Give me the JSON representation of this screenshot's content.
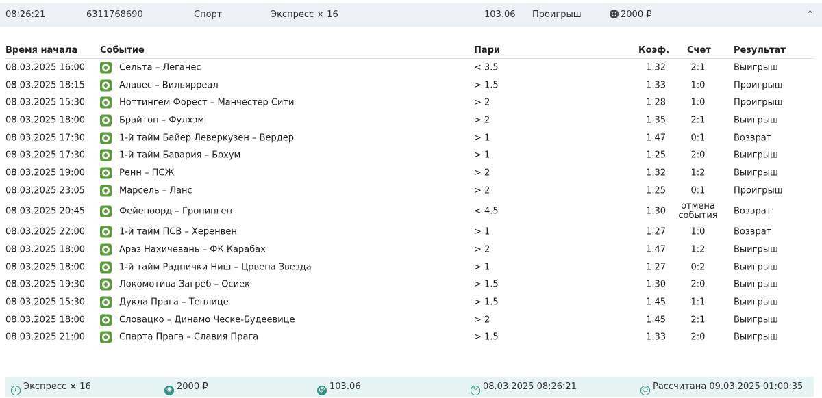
{
  "topbar": {
    "time": "08:26:21",
    "id": "6311768690",
    "category": "Спорт",
    "type": "Экспресс × 16",
    "coef": "103.06",
    "status": "Проигрыш",
    "stake": "2000 ₽"
  },
  "headers": {
    "start": "Время начала",
    "event": "Событие",
    "bet": "Пари",
    "coef": "Коэф.",
    "score": "Счет",
    "result": "Результат"
  },
  "rows": [
    {
      "start": "08.03.2025 16:00",
      "event": "Сельта – Леганес",
      "bet": "< 3.5",
      "coef": "1.32",
      "score": "2:1",
      "result": "Выигрыш"
    },
    {
      "start": "08.03.2025 18:15",
      "event": "Алавес – Вильярреал",
      "bet": "> 1.5",
      "coef": "1.33",
      "score": "1:0",
      "result": "Проигрыш"
    },
    {
      "start": "08.03.2025 15:30",
      "event": "Ноттингем Форест – Манчестер Сити",
      "bet": "> 2",
      "coef": "1.28",
      "score": "1:0",
      "result": "Проигрыш"
    },
    {
      "start": "08.03.2025 18:00",
      "event": "Брайтон – Фулхэм",
      "bet": "> 2",
      "coef": "1.35",
      "score": "2:1",
      "result": "Выигрыш"
    },
    {
      "start": "08.03.2025 17:30",
      "event": "1-й тайм Байер Леверкузен – Вердер",
      "bet": "> 1",
      "coef": "1.47",
      "score": "0:1",
      "result": "Возврат"
    },
    {
      "start": "08.03.2025 17:30",
      "event": "1-й тайм Бавария – Бохум",
      "bet": "> 1",
      "coef": "1.25",
      "score": "2:0",
      "result": "Выигрыш"
    },
    {
      "start": "08.03.2025 19:00",
      "event": "Ренн – ПСЖ",
      "bet": "> 2",
      "coef": "1.32",
      "score": "1:2",
      "result": "Выигрыш"
    },
    {
      "start": "08.03.2025 23:05",
      "event": "Марсель – Ланс",
      "bet": "> 2",
      "coef": "1.25",
      "score": "0:1",
      "result": "Проигрыш"
    },
    {
      "start": "08.03.2025 20:45",
      "event": "Фейеноорд – Гронинген",
      "bet": "< 4.5",
      "coef": "1.30",
      "score": "отмена",
      "score2": "события",
      "result": "Возврат"
    },
    {
      "start": "08.03.2025 22:00",
      "event": "1-й тайм ПСВ – Херенвен",
      "bet": "> 1",
      "coef": "1.27",
      "score": "1:0",
      "result": "Возврат"
    },
    {
      "start": "08.03.2025 18:00",
      "event": "Араз Нахичевань – ФК Карабах",
      "bet": "> 2",
      "coef": "1.47",
      "score": "1:2",
      "result": "Выигрыш"
    },
    {
      "start": "08.03.2025 18:00",
      "event": "1-й тайм Раднички Ниш – Црвена Звезда",
      "bet": "> 1",
      "coef": "1.27",
      "score": "0:2",
      "result": "Выигрыш"
    },
    {
      "start": "08.03.2025 19:30",
      "event": "Локомотива Загреб – Осиек",
      "bet": "> 1.5",
      "coef": "1.30",
      "score": "2:0",
      "result": "Выигрыш"
    },
    {
      "start": "08.03.2025 15:30",
      "event": "Дукла Прага – Теплице",
      "bet": "> 1.5",
      "coef": "1.45",
      "score": "1:1",
      "result": "Выигрыш"
    },
    {
      "start": "08.03.2025 18:00",
      "event": "Словацко – Динамо Ческе-Будеевице",
      "bet": "> 2",
      "coef": "1.45",
      "score": "2:1",
      "result": "Выигрыш"
    },
    {
      "start": "08.03.2025 21:00",
      "event": "Спарта Прага – Славия Прага",
      "bet": "> 1.5",
      "coef": "1.33",
      "score": "2:0",
      "result": "Выигрыш"
    }
  ],
  "footer": {
    "type": "Экспресс × 16",
    "stake": "2000 ₽",
    "coef": "103.06",
    "created": "08.03.2025 08:26:21",
    "settled": "Рассчитана 09.03.2025 01:00:35"
  }
}
